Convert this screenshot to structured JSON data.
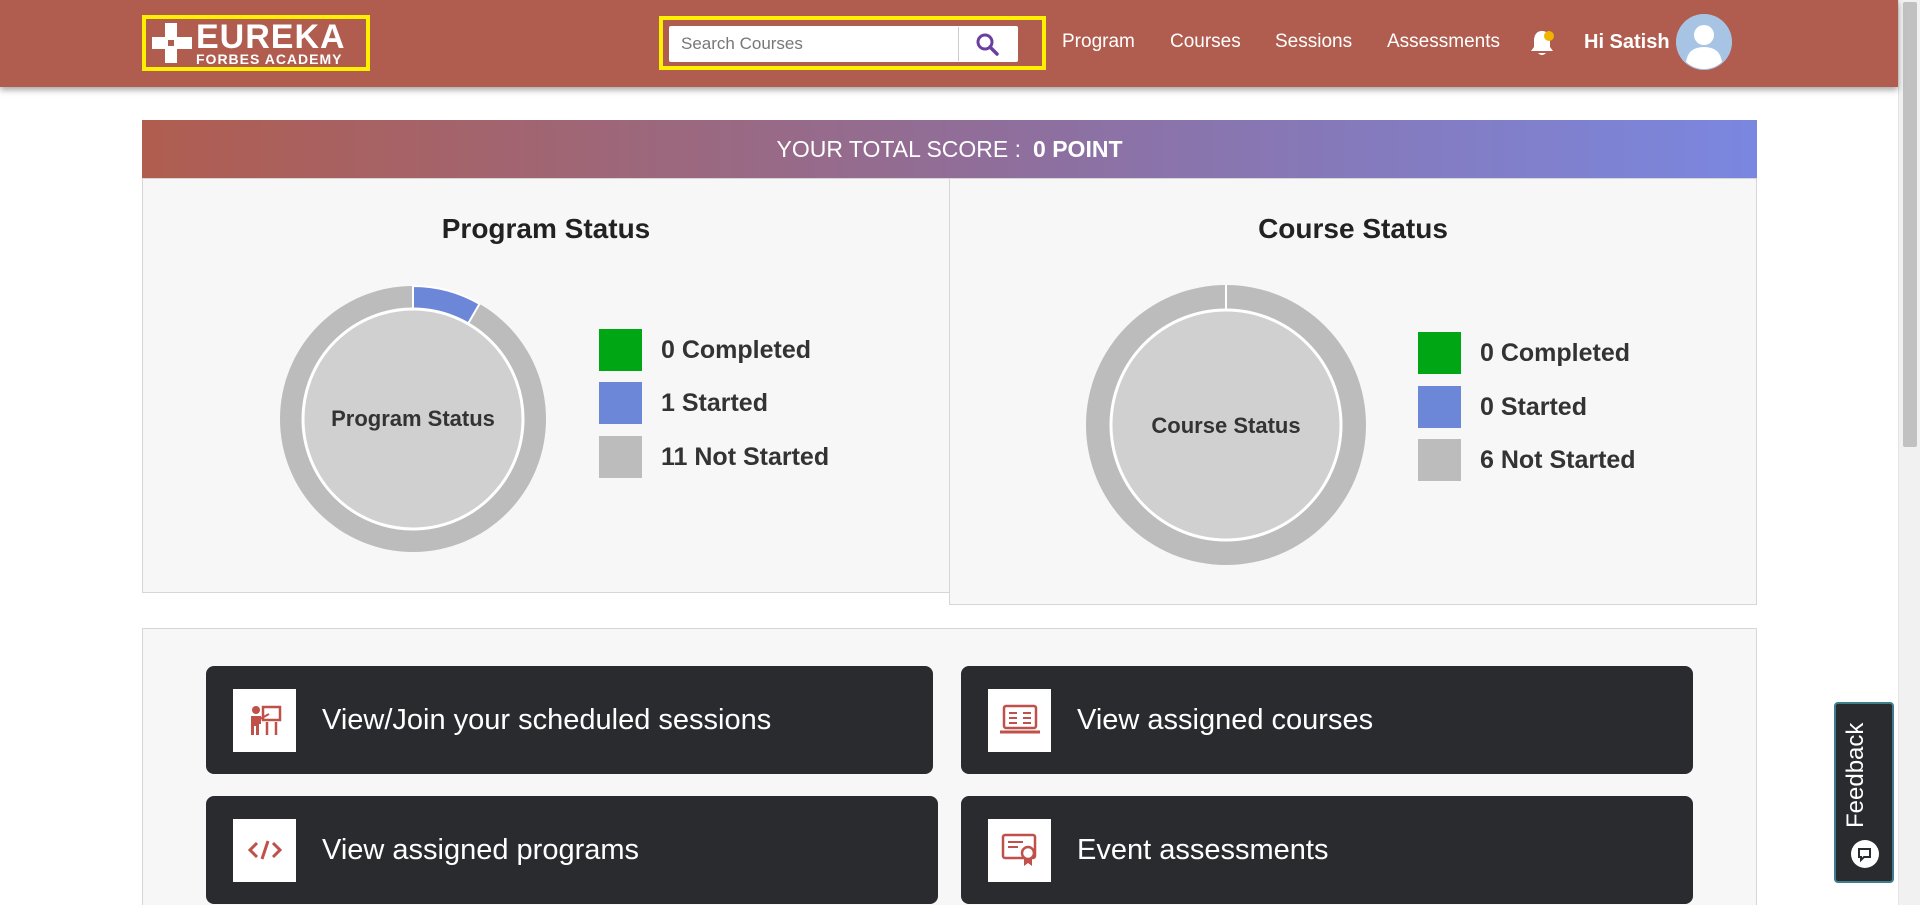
{
  "header": {
    "logo": {
      "line1": "EUREKA",
      "line2": "Forbes Academy"
    },
    "search": {
      "placeholder": "Search Courses",
      "icon": "search-icon"
    },
    "nav": [
      "Program",
      "Courses",
      "Sessions",
      "Assessments"
    ],
    "notification_icon": "bell-icon",
    "greeting": "Hi Satish",
    "avatar_icon": "user-avatar-icon"
  },
  "score": {
    "label": "YOUR TOTAL SCORE :",
    "value": "0 POINT"
  },
  "program_status": {
    "title": "Program Status",
    "center_label": "Program Status",
    "legend": [
      {
        "text": "0 Completed",
        "count": 0,
        "color": "#00a614"
      },
      {
        "text": "1 Started",
        "count": 1,
        "color": "#6c87d8"
      },
      {
        "text": "11 Not Started",
        "count": 11,
        "color": "#bcbcbc"
      }
    ]
  },
  "course_status": {
    "title": "Course Status",
    "center_label": "Course Status",
    "legend": [
      {
        "text": "0 Completed",
        "count": 0,
        "color": "#00a614"
      },
      {
        "text": "0 Started",
        "count": 0,
        "color": "#6c87d8"
      },
      {
        "text": "6 Not Started",
        "count": 6,
        "color": "#bcbcbc"
      }
    ]
  },
  "quick_links": [
    {
      "label": "View/Join your scheduled sessions",
      "icon": "presentation-icon"
    },
    {
      "label": "View assigned courses",
      "icon": "course-book-icon"
    },
    {
      "label": "View assigned programs",
      "icon": "code-icon"
    },
    {
      "label": "Event assessments",
      "icon": "certificate-icon"
    }
  ],
  "feedback": {
    "label": "Feedback"
  },
  "colors": {
    "header": "#b05d4f",
    "accent": "#ffef00",
    "card": "#292b2f",
    "icon_red": "#c0504a"
  }
}
